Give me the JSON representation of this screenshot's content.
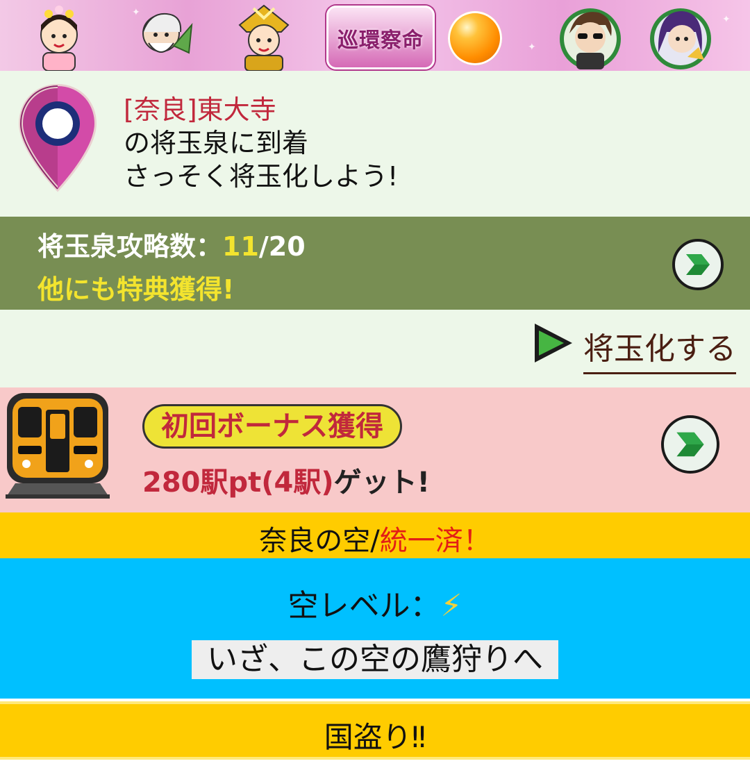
{
  "banner": {
    "event_logo_text": "巡環察命",
    "characters": [
      "princess-character-icon",
      "elder-character-icon",
      "samurai-character-icon",
      "sunglasses-character-icon",
      "purple-hair-character-icon"
    ]
  },
  "arrival": {
    "location": "[奈良]東大寺",
    "line2": "の将玉泉に到着",
    "line3": "さっそく将玉化しよう!"
  },
  "capture": {
    "label": "将玉泉攻略数：",
    "count": "11",
    "total": "/20",
    "subtitle": "他にも特典獲得!"
  },
  "action": {
    "label": "将玉化する"
  },
  "bonus": {
    "badge": "初回ボーナス獲得",
    "points": "280駅pt(4駅)",
    "points_tail": "ゲット!"
  },
  "sky": {
    "region": "奈良の空/",
    "status": "統一済！",
    "level_label": "空レベル：",
    "level_icon": "⚡",
    "hunt_label": "いざ、この空の鷹狩りへ"
  },
  "conquest": {
    "label": "国盗り‼"
  },
  "colors": {
    "arrival_bg": "#edf7e9",
    "capture_bg": "#788e53",
    "accent_yellow": "#f3e42e",
    "bonus_bg": "#f8c9c9",
    "sky_bar": "#ffcc00",
    "sky_level_bg": "#00c0ff",
    "location_red": "#c1283c"
  }
}
